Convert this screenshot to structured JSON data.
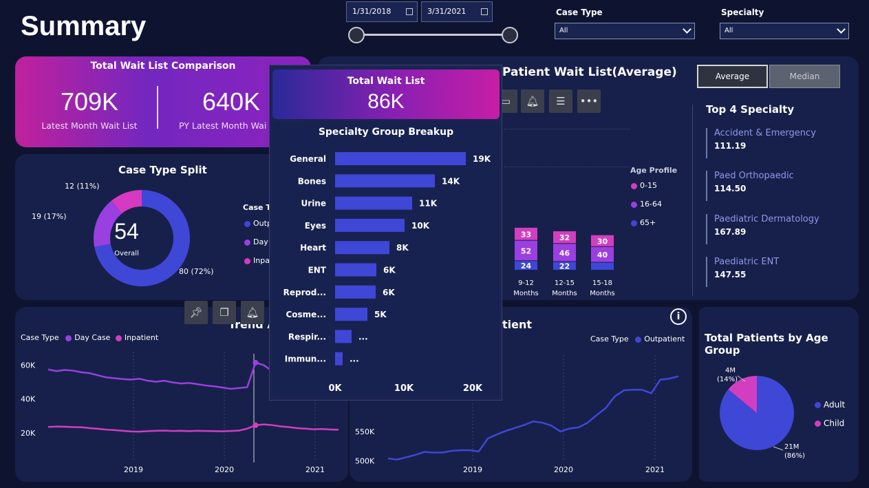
{
  "page": {
    "title": "Summary"
  },
  "date_filter": {
    "start": "1/31/2018",
    "end": "3/31/2021"
  },
  "filters": {
    "case_type": {
      "label": "Case Type",
      "value": "All"
    },
    "specialty": {
      "label": "Specialty",
      "value": "All"
    }
  },
  "comparison": {
    "title": "Total Wait List Comparison",
    "latest_value": "709K",
    "latest_label": "Latest Month Wait List",
    "py_value": "640K",
    "py_label": "PY Latest Month Wai"
  },
  "case_split": {
    "title": "Case Type Split",
    "center_value": "54",
    "center_label": "Overall",
    "labels": [
      "12 (11%)",
      "19 (17%)",
      "80 (72%)"
    ],
    "legend_title": "Case T",
    "legend": [
      "Outp",
      "Day",
      "Inpa"
    ],
    "chart_data": {
      "type": "pie",
      "categories": [
        "Outpatient",
        "Day Case",
        "Inpatient"
      ],
      "values": [
        80,
        19,
        12
      ],
      "colors": [
        "#3f47d6",
        "#9a3fe0",
        "#d63ac0"
      ]
    }
  },
  "patient_wait": {
    "title": "Patient Wait List(Average)",
    "age_profile_title": "Age Profile",
    "age_legend": [
      "0-15",
      "16-64",
      "65+"
    ],
    "colors": {
      "a0_15": "#d13fc0",
      "a16_64": "#9b3fe0",
      "a65": "#3f47d6"
    },
    "chart_data": {
      "type": "bar",
      "categories": [
        "9-12 Months",
        "12-15 Months",
        "15-18 Months"
      ],
      "series": [
        {
          "name": "65+",
          "values": [
            24,
            22,
            20
          ]
        },
        {
          "name": "16-64",
          "values": [
            52,
            46,
            40
          ]
        },
        {
          "name": "0-15",
          "values": [
            33,
            32,
            30
          ]
        }
      ]
    },
    "bar_labels": {
      "top": [
        "33",
        "32",
        "30"
      ],
      "mid": [
        "52",
        "46",
        "40"
      ],
      "bottom": [
        "24",
        "22",
        ""
      ]
    },
    "cat_line1": [
      "9-12",
      "12-15",
      "15-18"
    ],
    "cat_line2": [
      "Months",
      "Months",
      "Months"
    ]
  },
  "toggle": {
    "average": "Average",
    "median": "Median"
  },
  "top_specialty": {
    "title": "Top 4 Specialty",
    "items": [
      {
        "name": "Accident & Emergency",
        "value": "111.19"
      },
      {
        "name": "Paed Orthopaedic",
        "value": "114.50"
      },
      {
        "name": "Paediatric Dermatology",
        "value": "167.89"
      },
      {
        "name": "Paediatric ENT",
        "value": "147.55"
      }
    ]
  },
  "trend_left": {
    "title": "Trend A",
    "legend_label": "Case Type",
    "legend": [
      "Day Case",
      "Inpatient"
    ],
    "yticks": [
      "60K",
      "40K",
      "20K"
    ],
    "xticks": [
      "2019",
      "2020",
      "2021"
    ],
    "chart_data": {
      "type": "line",
      "ylim": [
        0,
        70000
      ],
      "series": [
        {
          "name": "Day Case",
          "values": [
            57500,
            56500,
            57200,
            56800,
            55800,
            55300,
            54000,
            52800,
            52300,
            51800,
            51500,
            52000,
            50800,
            50200,
            50800,
            49800,
            49200,
            49500,
            48800,
            48000,
            47500,
            46800,
            46000,
            46500,
            47000,
            61500,
            60000,
            56500,
            57000,
            56200,
            56500,
            55800,
            55000,
            54500,
            55200,
            54800
          ]
        },
        {
          "name": "Inpatient",
          "values": [
            23500,
            23700,
            23600,
            23400,
            23300,
            22800,
            22400,
            21900,
            21600,
            21200,
            20800,
            20700,
            21000,
            21200,
            21300,
            21100,
            21200,
            21000,
            21200,
            21100,
            21000,
            20900,
            21100,
            21300,
            22500,
            24500,
            25000,
            24600,
            23800,
            23400,
            22800,
            22500,
            22100,
            22300,
            22000,
            21800
          ]
        }
      ]
    }
  },
  "trend_right": {
    "title_fragment": "tient",
    "legend_label": "Case Type",
    "legend": [
      "Outpatient"
    ],
    "yticks": [
      "550K",
      "500K"
    ],
    "xticks": [
      "2019",
      "2020",
      "2021"
    ],
    "chart_data": {
      "type": "line",
      "ylim": [
        490000,
        680000
      ],
      "series": [
        {
          "name": "Outpatient",
          "values": [
            504000,
            502000,
            506000,
            510000,
            515000,
            514000,
            514000,
            517000,
            518000,
            518000,
            516000,
            538000,
            545000,
            551000,
            556000,
            561000,
            567000,
            565000,
            560000,
            550000,
            555000,
            557000,
            565000,
            578000,
            590000,
            610000,
            620000,
            621000,
            621000,
            615000,
            638000,
            640000,
            644000
          ]
        }
      ]
    }
  },
  "age_group": {
    "title": "Total Patients by Age Group",
    "legend": [
      "Adult",
      "Child"
    ],
    "labels": {
      "adult_1": "21M",
      "adult_2": "(86%)",
      "child_1": "4M",
      "child_2": "(14%)"
    },
    "chart_data": {
      "type": "pie",
      "categories": [
        "Adult",
        "Child"
      ],
      "values": [
        86,
        14
      ],
      "colors": [
        "#3f47d6",
        "#d13fc0"
      ]
    }
  },
  "tooltip": {
    "header_title": "Total Wait List",
    "header_value": "86K",
    "breakup_title": "Specialty Group Breakup",
    "xticks": [
      "0K",
      "10K",
      "20K"
    ],
    "chart_data": {
      "type": "bar",
      "categories": [
        "General",
        "Bones",
        "Urine",
        "Eyes",
        "Heart",
        "ENT",
        "Reprod...",
        "Cosme...",
        "Respir...",
        "Immun..."
      ],
      "values": [
        19000,
        14500,
        11200,
        10100,
        7900,
        6000,
        5900,
        4700,
        2400,
        1100
      ],
      "value_labels": [
        "19K",
        "14K",
        "11K",
        "10K",
        "8K",
        "6K",
        "6K",
        "5K",
        "...",
        "..."
      ],
      "xlim": [
        0,
        20000
      ]
    }
  }
}
